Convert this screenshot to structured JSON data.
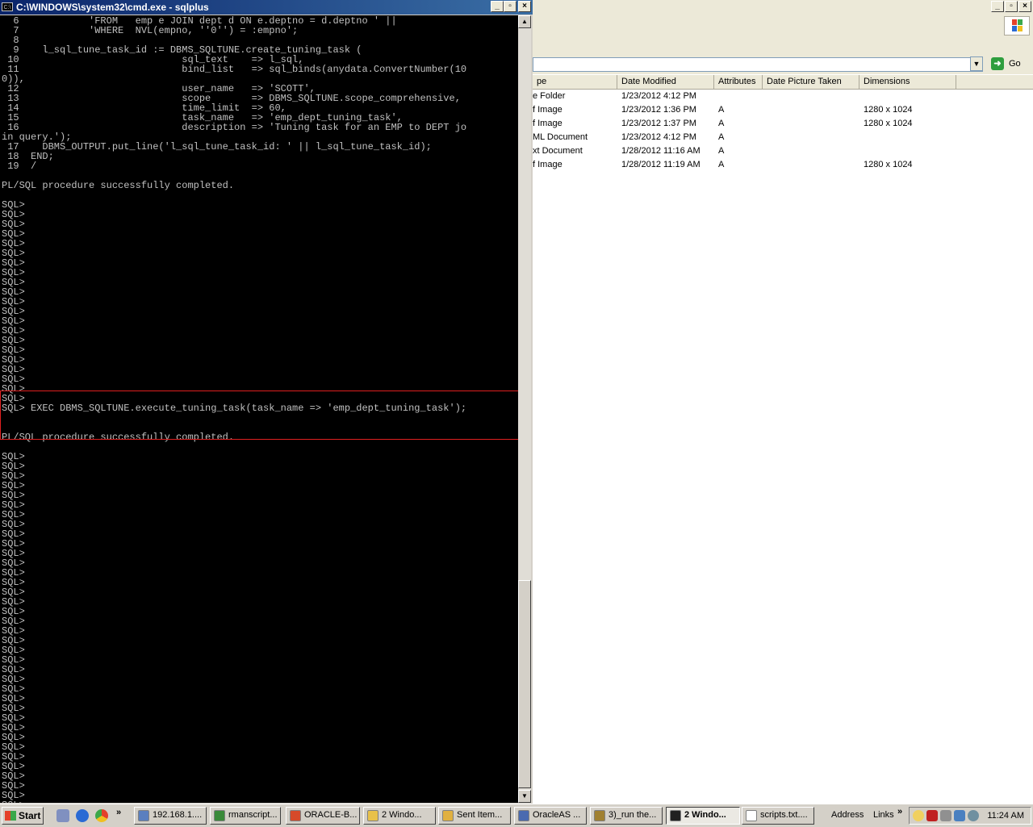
{
  "explorer": {
    "address_value": "",
    "go_label": "Go",
    "columns": [
      "pe",
      "Date Modified",
      "Attributes",
      "Date Picture Taken",
      "Dimensions"
    ],
    "files": [
      {
        "type": "e Folder",
        "date": "1/23/2012 4:12 PM",
        "attr": "",
        "taken": "",
        "dims": ""
      },
      {
        "type": "f Image",
        "date": "1/23/2012 1:36 PM",
        "attr": "A",
        "taken": "",
        "dims": "1280 x 1024"
      },
      {
        "type": "f Image",
        "date": "1/23/2012 1:37 PM",
        "attr": "A",
        "taken": "",
        "dims": "1280 x 1024"
      },
      {
        "type": "ML Document",
        "date": "1/23/2012 4:12 PM",
        "attr": "A",
        "taken": "",
        "dims": ""
      },
      {
        "type": "xt Document",
        "date": "1/28/2012 11:16 AM",
        "attr": "A",
        "taken": "",
        "dims": ""
      },
      {
        "type": "f Image",
        "date": "1/28/2012 11:19 AM",
        "attr": "A",
        "taken": "",
        "dims": "1280 x 1024"
      }
    ]
  },
  "console": {
    "title": "C:\\WINDOWS\\system32\\cmd.exe - sqlplus",
    "icon_label": "C:\\",
    "lines": [
      "  6            'FROM   emp e JOIN dept d ON e.deptno = d.deptno ' ||",
      "  7            'WHERE  NVL(empno, ''0'') = :empno';",
      "  8",
      "  9    l_sql_tune_task_id := DBMS_SQLTUNE.create_tuning_task (",
      " 10                            sql_text    => l_sql,",
      " 11                            bind_list   => sql_binds(anydata.ConvertNumber(10",
      "0)),",
      " 12                            user_name   => 'SCOTT',",
      " 13                            scope       => DBMS_SQLTUNE.scope_comprehensive,",
      " 14                            time_limit  => 60,",
      " 15                            task_name   => 'emp_dept_tuning_task',",
      " 16                            description => 'Tuning task for an EMP to DEPT jo",
      "in query.');",
      " 17    DBMS_OUTPUT.put_line('l_sql_tune_task_id: ' || l_sql_tune_task_id);",
      " 18  END;",
      " 19  /",
      "",
      "PL/SQL procedure successfully completed.",
      "",
      "SQL>",
      "SQL>",
      "SQL>",
      "SQL>",
      "SQL>",
      "SQL>",
      "SQL>",
      "SQL>",
      "SQL>",
      "SQL>",
      "SQL>",
      "SQL>",
      "SQL>",
      "SQL>",
      "SQL>",
      "SQL>",
      "SQL>",
      "SQL>",
      "SQL>",
      "SQL>",
      "SQL>",
      "SQL> EXEC DBMS_SQLTUNE.execute_tuning_task(task_name => 'emp_dept_tuning_task');",
      "",
      "",
      "PL/SQL procedure successfully completed.",
      "",
      "SQL>",
      "SQL>",
      "SQL>",
      "SQL>",
      "SQL>",
      "SQL>",
      "SQL>",
      "SQL>",
      "SQL>",
      "SQL>",
      "SQL>",
      "SQL>",
      "SQL>",
      "SQL>",
      "SQL>",
      "SQL>",
      "SQL>",
      "SQL>",
      "SQL>",
      "SQL>",
      "SQL>",
      "SQL>",
      "SQL>",
      "SQL>",
      "SQL>",
      "SQL>",
      "SQL>",
      "SQL>",
      "SQL>",
      "SQL>",
      "SQL>",
      "SQL>",
      "SQL>",
      "SQL>",
      "SQL>",
      "SQL>",
      "SQL>"
    ]
  },
  "taskbar": {
    "start_label": "Start",
    "quick_launch_more": "»",
    "tasks": [
      {
        "label": "192.168.1....",
        "color": "#5a7fbf"
      },
      {
        "label": "rmanscript...",
        "color": "#3a8a3a"
      },
      {
        "label": "ORACLE-B...",
        "color": "#d64a2a"
      },
      {
        "label": "2 Windo...",
        "color": "#e8c14a"
      },
      {
        "label": "Sent Item...",
        "color": "#e0b040"
      },
      {
        "label": "OracleAS ...",
        "color": "#4a6ab0"
      },
      {
        "label": "3)_run the...",
        "color": "#a08030"
      },
      {
        "label": "2 Windo...",
        "color": "#202020"
      },
      {
        "label": "scripts.txt....",
        "color": "#ffffff"
      }
    ],
    "address_label": "Address",
    "links_label": "Links",
    "links_more": "»",
    "clock": "11:24 AM"
  },
  "colors": {
    "console_bg": "#000000",
    "console_fg": "#c0c0c0",
    "highlight": "#e02020",
    "title_active": "#0a246a"
  }
}
